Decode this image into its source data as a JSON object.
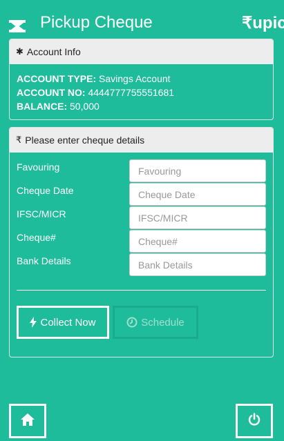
{
  "header": {
    "title": "Pickup Cheque",
    "brand": "₹upic"
  },
  "account": {
    "heading": "Account Info",
    "type_label": "ACCOUNT TYPE:",
    "type_value": "Savings Account",
    "no_label": "ACCOUNT NO:",
    "no_value": "4444777755551681",
    "balance_label": "BALANCE:",
    "balance_value": "50,000"
  },
  "cheque": {
    "heading": "Please enter cheque details",
    "heading_glyph": "₹",
    "fields": [
      {
        "label": "Favouring",
        "placeholder": "Favouring",
        "value": ""
      },
      {
        "label": "Cheque Date",
        "placeholder": "Cheque Date",
        "value": ""
      },
      {
        "label": "IFSC/MICR",
        "placeholder": "IFSC/MICR",
        "value": ""
      },
      {
        "label": "Cheque#",
        "placeholder": "Cheque#",
        "value": ""
      },
      {
        "label": "Bank Details",
        "placeholder": "Bank Details",
        "value": ""
      }
    ],
    "collect_label": "Collect Now",
    "schedule_label": "Schedule"
  },
  "icons": {
    "menu": "menu-icon",
    "info": "asterisk-icon",
    "cheque": "rupee-icon",
    "collect": "bolt-icon",
    "schedule": "clock-icon",
    "home": "home-icon",
    "power": "power-icon"
  },
  "colors": {
    "background": "#1fbc9c",
    "card_header": "#ededed",
    "text": "#ffffff"
  }
}
